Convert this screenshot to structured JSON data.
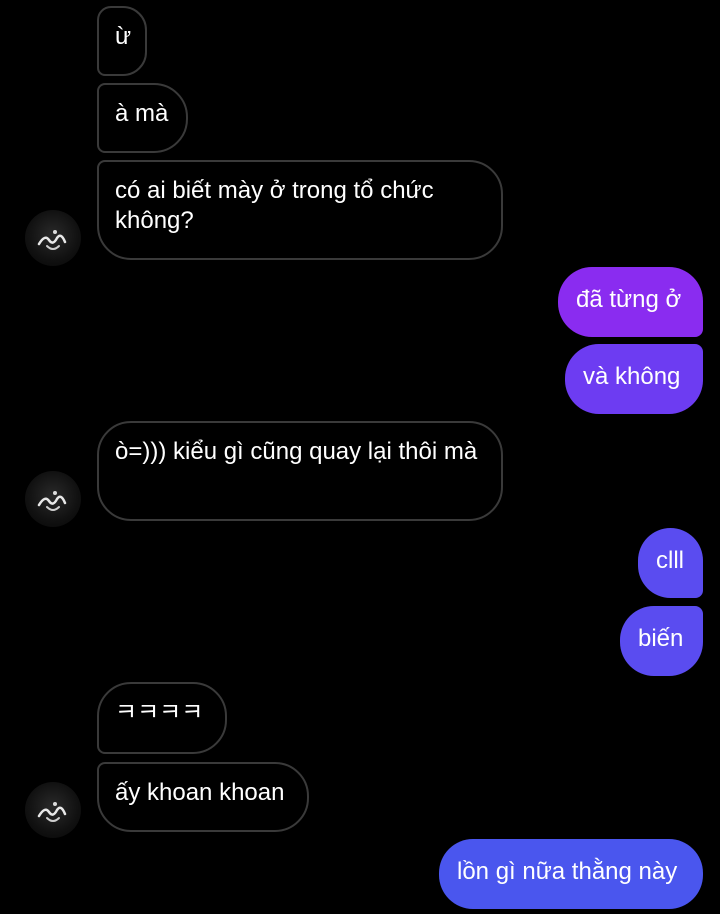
{
  "conversation": {
    "messages": [
      {
        "id": "m1",
        "direction": "incoming",
        "text": "ừ"
      },
      {
        "id": "m2",
        "direction": "incoming",
        "text": "à mà"
      },
      {
        "id": "m3",
        "direction": "incoming",
        "text": "có ai biết mày ở trong tổ chức không?"
      },
      {
        "id": "m4",
        "direction": "outgoing",
        "text": "đã từng ở"
      },
      {
        "id": "m5",
        "direction": "outgoing",
        "text": "và không"
      },
      {
        "id": "m6",
        "direction": "incoming",
        "text": "ò=))) kiểu gì cũng quay lại thôi mà"
      },
      {
        "id": "m7",
        "direction": "outgoing",
        "text": "clll"
      },
      {
        "id": "m8",
        "direction": "outgoing",
        "text": "biến"
      },
      {
        "id": "m9",
        "direction": "incoming",
        "text": "ㅋㅋㅋㅋ"
      },
      {
        "id": "m10",
        "direction": "incoming",
        "text": "ấy khoan khoan"
      },
      {
        "id": "m11",
        "direction": "outgoing",
        "text": "lồn gì nữa thằng này"
      }
    ]
  },
  "colors": {
    "background": "#000000",
    "incoming_border": "#3a3a3a",
    "outgoing_purple": "#8a2cf0",
    "outgoing_violet": "#6d3cf2",
    "outgoing_indigo": "#5a4cf0",
    "outgoing_blue": "#4a56ee",
    "text": "#ffffff"
  },
  "avatar": {
    "icon": "contact-avatar"
  }
}
